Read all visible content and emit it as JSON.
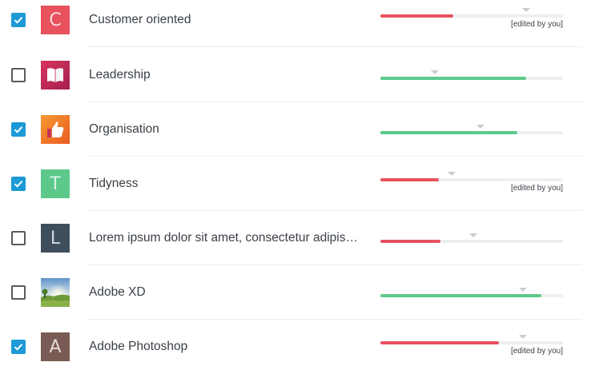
{
  "colors": {
    "checkbox_checked": "#1d9ad6",
    "bar_red": "#e8525d",
    "bar_green": "#5cc98a",
    "track": "#efefef"
  },
  "items": [
    {
      "label": "Customer oriented",
      "checked": true,
      "thumb": {
        "type": "letter",
        "letter": "C",
        "color": "#e8525d"
      },
      "progress": 0.4,
      "marker": 0.8,
      "bar_color": "red",
      "edited": "[edited by you]"
    },
    {
      "label": "Leadership",
      "checked": false,
      "thumb": {
        "type": "image",
        "icon": "book-icon",
        "color": "#c0285a"
      },
      "progress": 0.8,
      "marker": 0.3,
      "bar_color": "green",
      "edited": null
    },
    {
      "label": "Organisation",
      "checked": true,
      "thumb": {
        "type": "image",
        "icon": "thumbs-up-icon",
        "color": "#f07a2a"
      },
      "progress": 0.75,
      "marker": 0.55,
      "bar_color": "green",
      "edited": null
    },
    {
      "label": "Tidyness",
      "checked": true,
      "thumb": {
        "type": "letter",
        "letter": "T",
        "color": "#5cc98a"
      },
      "progress": 0.32,
      "marker": 0.39,
      "bar_color": "red",
      "edited": "[edited by you]"
    },
    {
      "label": "Lorem ipsum dolor sit amet, consectetur adipiscing elit",
      "checked": false,
      "thumb": {
        "type": "letter",
        "letter": "L",
        "color": "#3f4e5c"
      },
      "progress": 0.33,
      "marker": 0.51,
      "bar_color": "red",
      "edited": null
    },
    {
      "label": "Adobe XD",
      "checked": false,
      "thumb": {
        "type": "image",
        "icon": "landscape-photo",
        "color": "#7aa3c9"
      },
      "progress": 0.88,
      "marker": 0.78,
      "bar_color": "green",
      "edited": null
    },
    {
      "label": "Adobe Photoshop",
      "checked": true,
      "thumb": {
        "type": "letter",
        "letter": "A",
        "color": "#7a5a54"
      },
      "progress": 0.65,
      "marker": 0.78,
      "bar_color": "red",
      "edited": "[edited by you]"
    }
  ]
}
